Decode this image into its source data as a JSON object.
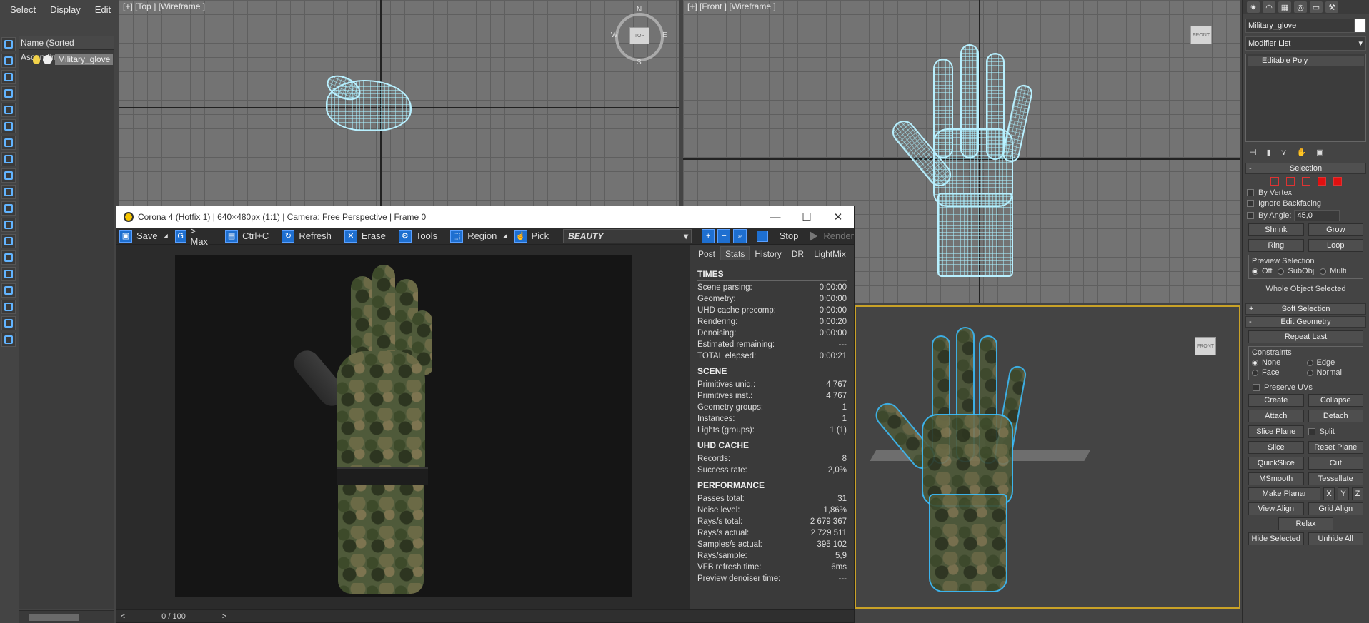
{
  "explorer": {
    "menu": [
      "Select",
      "Display",
      "Edit"
    ],
    "header": "Name (Sorted Ascending)",
    "object": "Military_glove"
  },
  "viewports": {
    "top_label": "[+] [Top ] [Wireframe ]",
    "front_label": "[+] [Front ] [Wireframe ]",
    "compass": {
      "n": "N",
      "s": "S",
      "e": "E",
      "w": "W",
      "cube": "TOP"
    },
    "front_cube": "FRONT",
    "persp_cube": "FRONT"
  },
  "vfb": {
    "title": "Corona 4 (Hotfix 1) | 640×480px (1:1) | Camera: Free Perspective | Frame 0",
    "toolbar": {
      "save": "Save",
      "to_max": "> Max",
      "copy": "Ctrl+C",
      "refresh": "Refresh",
      "erase": "Erase",
      "tools": "Tools",
      "region": "Region",
      "pick": "Pick",
      "pass": "BEAUTY",
      "stop": "Stop",
      "render": "Render"
    },
    "tabs": [
      "Post",
      "Stats",
      "History",
      "DR",
      "LightMix"
    ],
    "active_tab": "Stats",
    "stats": {
      "times": {
        "title": "TIMES",
        "rows": [
          [
            "Scene parsing:",
            "0:00:00"
          ],
          [
            "Geometry:",
            "0:00:00"
          ],
          [
            "UHD cache precomp:",
            "0:00:00"
          ],
          [
            "Rendering:",
            "0:00:20"
          ],
          [
            "Denoising:",
            "0:00:00"
          ],
          [
            "Estimated remaining:",
            "---"
          ],
          [
            "TOTAL elapsed:",
            "0:00:21"
          ]
        ]
      },
      "scene": {
        "title": "SCENE",
        "rows": [
          [
            "Primitives uniq.:",
            "4 767"
          ],
          [
            "Primitives inst.:",
            "4 767"
          ],
          [
            "Geometry groups:",
            "1"
          ],
          [
            "Instances:",
            "1"
          ],
          [
            "Lights (groups):",
            "1 (1)"
          ]
        ]
      },
      "uhd": {
        "title": "UHD CACHE",
        "rows": [
          [
            "Records:",
            "8"
          ],
          [
            "Success rate:",
            "2,0%"
          ]
        ]
      },
      "performance": {
        "title": "PERFORMANCE",
        "rows": [
          [
            "Passes total:",
            "31"
          ],
          [
            "Noise level:",
            "1,86%"
          ],
          [
            "Rays/s total:",
            "2 679 367"
          ],
          [
            "Rays/s actual:",
            "2 729 511"
          ],
          [
            "Samples/s actual:",
            "395 102"
          ],
          [
            "Rays/sample:",
            "5,9"
          ],
          [
            "VFB refresh time:",
            "6ms"
          ],
          [
            "Preview denoiser time:",
            "---"
          ]
        ]
      }
    },
    "status": {
      "prev": "<",
      "page": "0 / 100",
      "next": ">"
    }
  },
  "command_panel": {
    "object_name": "Military_glove",
    "modifier_list": "Modifier List",
    "stack_item": "Editable Poly",
    "selection": {
      "title": "Selection",
      "by_vertex": "By Vertex",
      "ignore_backfacing": "Ignore Backfacing",
      "by_angle": "By Angle:",
      "angle_value": "45,0",
      "shrink": "Shrink",
      "grow": "Grow",
      "ring": "Ring",
      "loop": "Loop",
      "preview_title": "Preview Selection",
      "preview_off": "Off",
      "preview_subobj": "SubObj",
      "preview_multi": "Multi",
      "status": "Whole Object Selected"
    },
    "soft_selection": "Soft Selection",
    "edit_geometry": {
      "title": "Edit Geometry",
      "repeat_last": "Repeat Last",
      "constraints": "Constraints",
      "none": "None",
      "edge": "Edge",
      "face": "Face",
      "normal": "Normal",
      "preserve_uvs": "Preserve UVs",
      "create": "Create",
      "collapse": "Collapse",
      "attach": "Attach",
      "detach": "Detach",
      "slice_plane": "Slice Plane",
      "split": "Split",
      "slice": "Slice",
      "reset_plane": "Reset Plane",
      "quickslice": "QuickSlice",
      "cut": "Cut",
      "msmooth": "MSmooth",
      "tessellate": "Tessellate",
      "make_planar": "Make Planar",
      "x": "X",
      "y": "Y",
      "z": "Z",
      "view_align": "View Align",
      "grid_align": "Grid Align",
      "relax": "Relax",
      "hide_selected": "Hide Selected",
      "unhide_all": "Unhide All"
    }
  }
}
